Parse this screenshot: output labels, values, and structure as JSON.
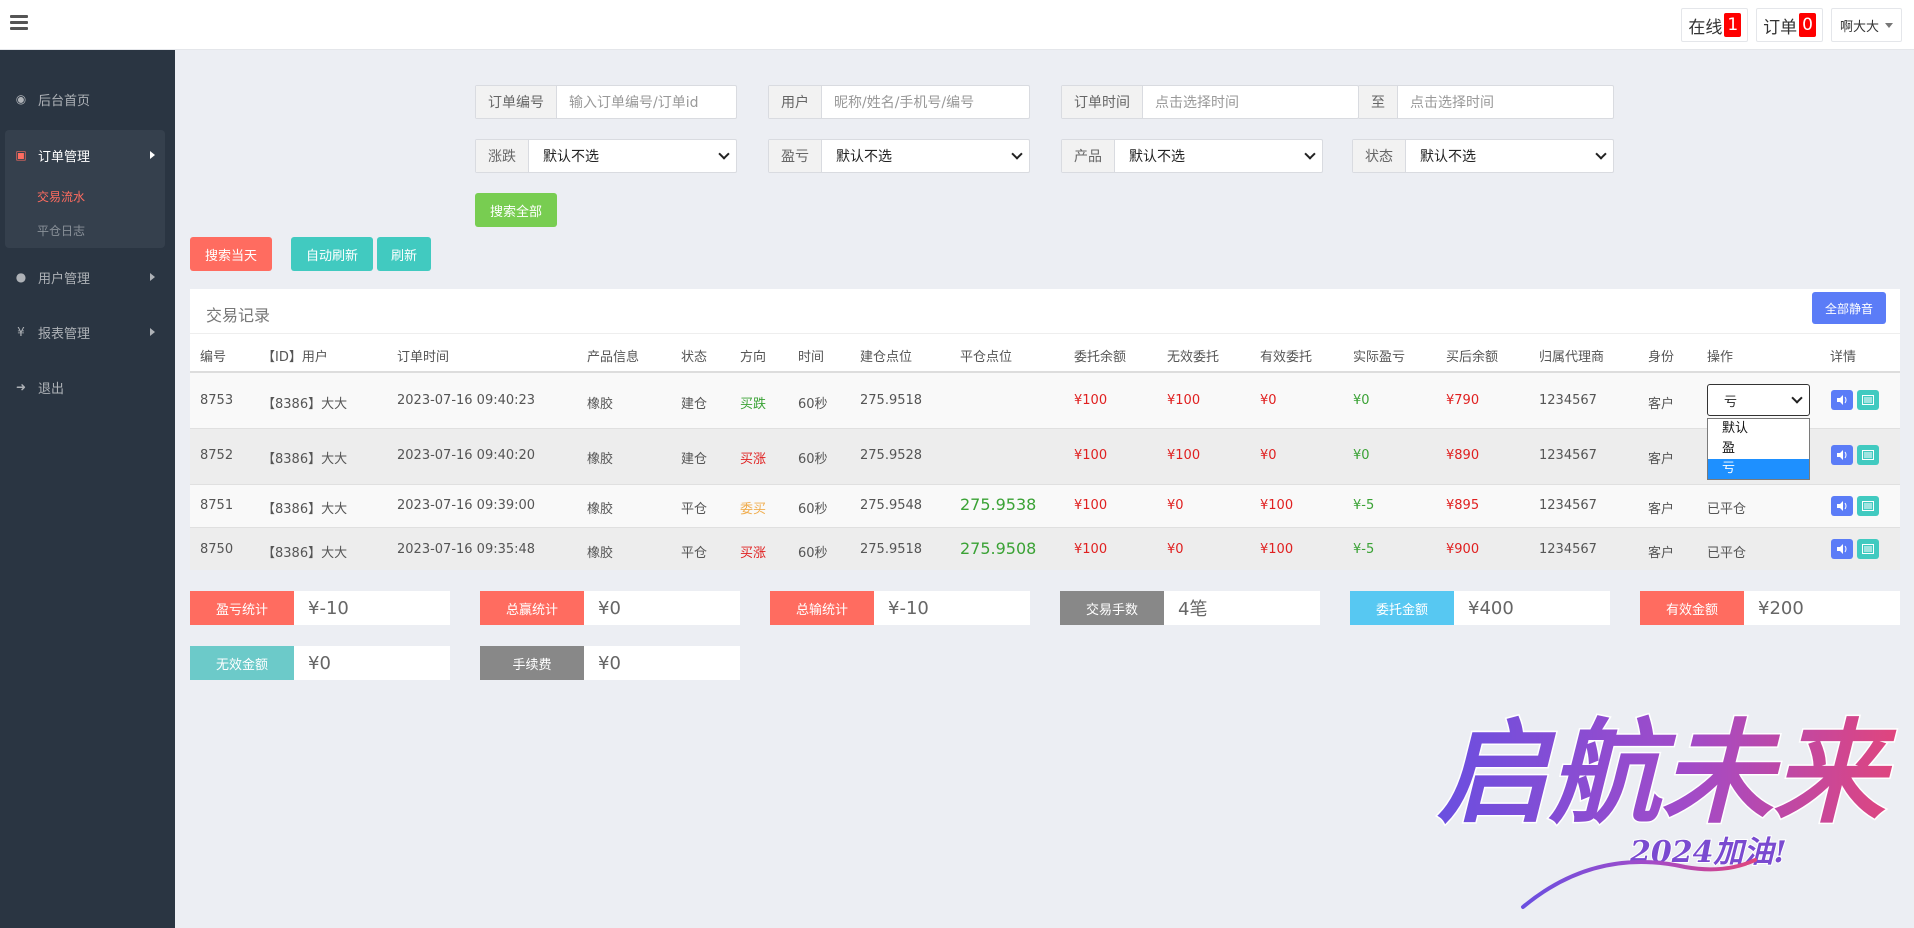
{
  "header": {
    "online_label": "在线",
    "online_count": "1",
    "orders_label": "订单",
    "orders_count": "0",
    "user_name": "啊大大"
  },
  "sidebar": {
    "items": [
      {
        "label": "后台首页",
        "icon": "dashboard-icon"
      },
      {
        "label": "订单管理",
        "icon": "orders-icon"
      },
      {
        "label": "用户管理",
        "icon": "user-icon"
      },
      {
        "label": "报表管理",
        "icon": "yen-icon"
      },
      {
        "label": "退出",
        "icon": "logout-icon"
      }
    ],
    "submenu": [
      "交易流水",
      "平仓日志"
    ]
  },
  "filters": {
    "order_no_label": "订单编号",
    "order_no_placeholder": "输入订单编号/订单id",
    "user_label": "用户",
    "user_placeholder": "昵称/姓名/手机号/编号",
    "time_label": "订单时间",
    "time_placeholder": "点击选择时间",
    "to_label": "至",
    "to_placeholder": "点击选择时间",
    "updown_label": "涨跌",
    "updown_value": "默认不选",
    "pl_label": "盈亏",
    "pl_value": "默认不选",
    "product_label": "产品",
    "product_value": "默认不选",
    "status_label": "状态",
    "status_value": "默认不选"
  },
  "buttons": {
    "search_all": "搜索全部",
    "search_today": "搜索当天",
    "auto_refresh": "自动刷新",
    "refresh": "刷新",
    "mute_all": "全部静音"
  },
  "colors": {
    "red_btn": "#ff6c60",
    "teal_btn": "#41cac0",
    "green_btn": "#78cd51",
    "blue_btn": "#5b7cf7",
    "gray_btn": "#888888",
    "sky_btn": "#57c8f2",
    "sidebar_bg": "#2a3542"
  },
  "table": {
    "title": "交易记录",
    "columns": [
      "编号",
      "【ID】用户",
      "订单时间",
      "产品信息",
      "状态",
      "方向",
      "时间",
      "建仓点位",
      "平仓点位",
      "委托余额",
      "无效委托",
      "有效委托",
      "实际盈亏",
      "买后余额",
      "归属代理商",
      "身份",
      "操作",
      "详情"
    ],
    "rows": [
      {
        "id": "8753",
        "user": "【8386】大大",
        "time": "2023-07-16 09:40:23",
        "product": "橡胶",
        "status": "建仓",
        "direction": "买跌",
        "period": "60秒",
        "open": "275.9518",
        "close": "",
        "entrust": "¥100",
        "invalid": "¥100",
        "valid": "¥0",
        "pl": "¥0",
        "balance": "¥790",
        "agent": "1234567",
        "role": "客户",
        "op": "亏"
      },
      {
        "id": "8752",
        "user": "【8386】大大",
        "time": "2023-07-16 09:40:20",
        "product": "橡胶",
        "status": "建仓",
        "direction": "买涨",
        "period": "60秒",
        "open": "275.9528",
        "close": "",
        "entrust": "¥100",
        "invalid": "¥100",
        "valid": "¥0",
        "pl": "¥0",
        "balance": "¥890",
        "agent": "1234567",
        "role": "客户",
        "op": ""
      },
      {
        "id": "8751",
        "user": "【8386】大大",
        "time": "2023-07-16 09:39:00",
        "product": "橡胶",
        "status": "平仓",
        "direction": "委买",
        "period": "60秒",
        "open": "275.9548",
        "close": "275.9538",
        "entrust": "¥100",
        "invalid": "¥0",
        "valid": "¥100",
        "pl": "¥-5",
        "balance": "¥895",
        "agent": "1234567",
        "role": "客户",
        "op": "已平仓"
      },
      {
        "id": "8750",
        "user": "【8386】大大",
        "time": "2023-07-16 09:35:48",
        "product": "橡胶",
        "status": "平仓",
        "direction": "买涨",
        "period": "60秒",
        "open": "275.9518",
        "close": "275.9508",
        "entrust": "¥100",
        "invalid": "¥0",
        "valid": "¥100",
        "pl": "¥-5",
        "balance": "¥900",
        "agent": "1234567",
        "role": "客户",
        "op": "已平仓"
      }
    ],
    "op_options": [
      "默认",
      "盈",
      "亏"
    ]
  },
  "stats": [
    {
      "label": "盈亏统计",
      "value": "¥-10"
    },
    {
      "label": "总赢统计",
      "value": "¥0"
    },
    {
      "label": "总输统计",
      "value": "¥-10"
    },
    {
      "label": "交易手数",
      "value": "4笔"
    },
    {
      "label": "委托金额",
      "value": "¥400"
    },
    {
      "label": "有效金额",
      "value": "¥200"
    },
    {
      "label": "无效金额",
      "value": "¥0"
    },
    {
      "label": "手续费",
      "value": "¥0"
    }
  ],
  "watermark": {
    "main": "启航未来",
    "sub": "2024加油!"
  }
}
